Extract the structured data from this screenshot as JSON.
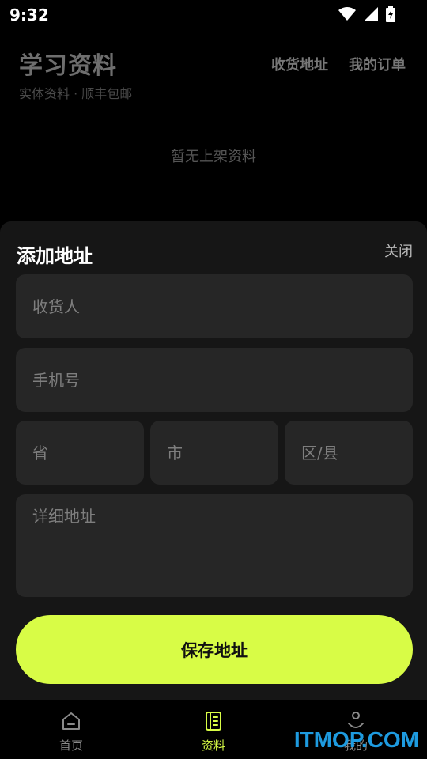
{
  "status_bar": {
    "time": "9:32",
    "icons": [
      "wifi-icon",
      "cellular-icon",
      "battery-charging-icon"
    ]
  },
  "header": {
    "title": "学习资料",
    "subtitle": "实体资料 · 顺丰包邮",
    "links": {
      "address": "收货地址",
      "orders": "我的订单"
    }
  },
  "main": {
    "empty_text": "暂无上架资料"
  },
  "sheet": {
    "title": "添加地址",
    "close_label": "关闭",
    "fields": {
      "name_placeholder": "收货人",
      "phone_placeholder": "手机号",
      "province_placeholder": "省",
      "city_placeholder": "市",
      "district_placeholder": "区/县",
      "detail_placeholder": "详细地址"
    },
    "save_label": "保存地址"
  },
  "bottom_nav": {
    "items": [
      {
        "label": "首页",
        "icon": "home-icon"
      },
      {
        "label": "资料",
        "icon": "book-icon",
        "active": true
      },
      {
        "label": "我的",
        "icon": "smiley-icon"
      }
    ]
  },
  "colors": {
    "accent": "#d8fc46",
    "background": "#000000",
    "sheet": "#161616",
    "field": "#262626"
  },
  "watermark": "ITMOP.COM"
}
